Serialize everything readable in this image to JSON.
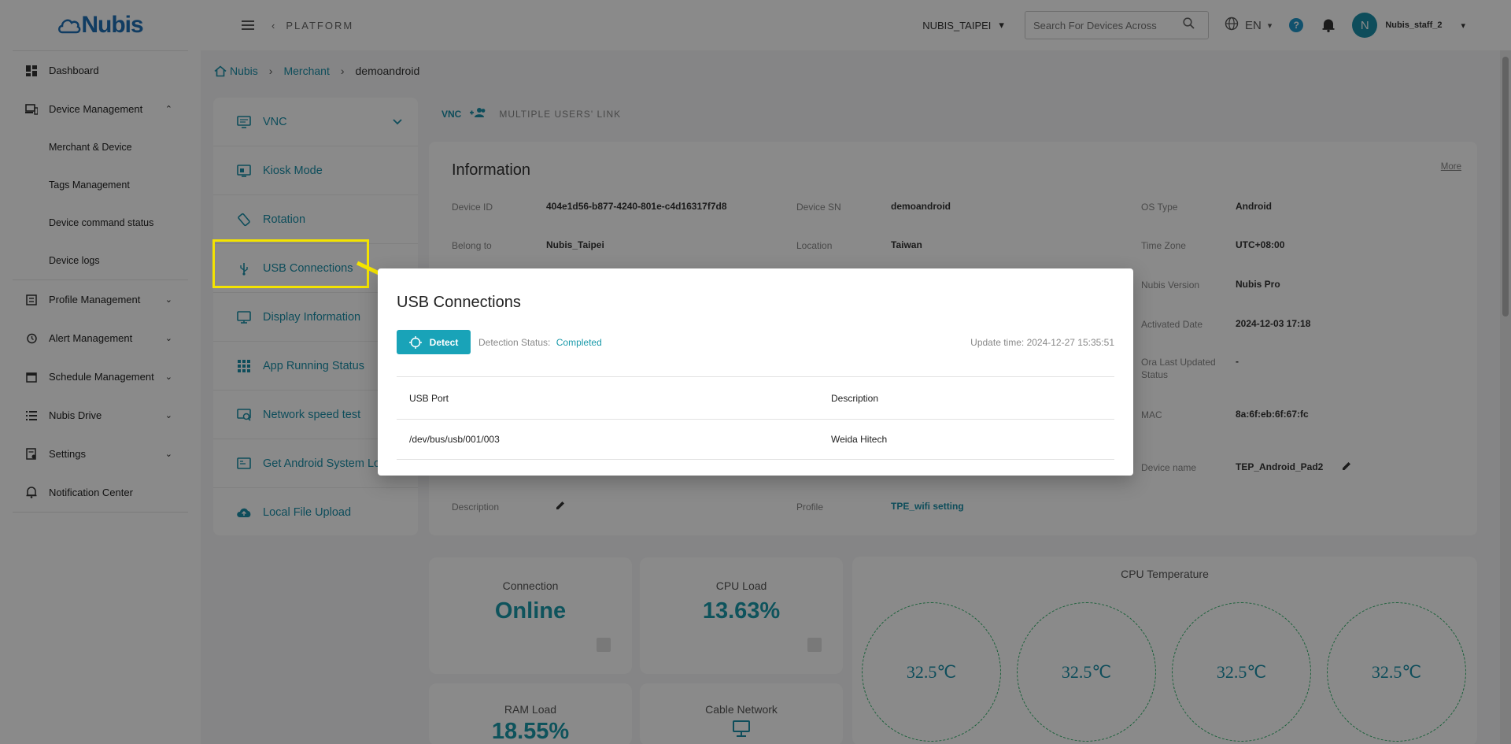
{
  "logo": {
    "text": "Nubis"
  },
  "sidebar": {
    "items": [
      {
        "label": "Dashboard",
        "icon": "dashboard-icon"
      },
      {
        "label": "Device Management",
        "icon": "devices-icon",
        "expanded": true,
        "children": [
          "Merchant & Device",
          "Tags Management",
          "Device command status",
          "Device logs"
        ]
      },
      {
        "label": "Profile Management",
        "icon": "profile-icon"
      },
      {
        "label": "Alert Management",
        "icon": "alarm-icon"
      },
      {
        "label": "Schedule Management",
        "icon": "calendar-icon"
      },
      {
        "label": "Nubis Drive",
        "icon": "list-icon"
      },
      {
        "label": "Settings",
        "icon": "settings-icon"
      },
      {
        "label": "Notification Center",
        "icon": "bell-icon"
      }
    ]
  },
  "header": {
    "platform_label": "PLATFORM",
    "merchant": "NUBIS_TAIPEI",
    "search_placeholder": "Search For Devices Across",
    "language": "EN",
    "help": "?",
    "user_initial": "N",
    "user_name": "Nubis_staff_2"
  },
  "breadcrumb": {
    "home": "Nubis",
    "middle": "Merchant",
    "current": "demoandroid"
  },
  "function_menu": [
    {
      "label": "VNC",
      "icon": "monitor-icon"
    },
    {
      "label": "Kiosk Mode",
      "icon": "kiosk-icon"
    },
    {
      "label": "Rotation",
      "icon": "rotation-icon"
    },
    {
      "label": "USB Connections",
      "icon": "usb-icon"
    },
    {
      "label": "Display Information",
      "icon": "display-icon"
    },
    {
      "label": "App Running Status",
      "icon": "apps-grid-icon"
    },
    {
      "label": "Network speed test",
      "icon": "speed-icon"
    },
    {
      "label": "Get Android System Log",
      "icon": "log-icon"
    },
    {
      "label": "Local File Upload",
      "icon": "cloud-upload-icon"
    }
  ],
  "tabs": {
    "vnc": "VNC",
    "multi": "MULTIPLE USERS' LINK"
  },
  "info": {
    "title": "Information",
    "more": "More",
    "fields": {
      "device_id": {
        "label": "Device ID",
        "value": "404e1d56-b877-4240-801e-c4d16317f7d8"
      },
      "device_sn": {
        "label": "Device SN",
        "value": "demoandroid"
      },
      "os_type": {
        "label": "OS Type",
        "value": "Android"
      },
      "belong_to": {
        "label": "Belong to",
        "value": "Nubis_Taipei"
      },
      "location": {
        "label": "Location",
        "value": "Taiwan"
      },
      "time_zone": {
        "label": "Time Zone",
        "value": "UTC+08:00"
      },
      "nubis_version": {
        "label": "Nubis Version",
        "value": "Nubis Pro"
      },
      "activated_date": {
        "label": "Activated Date",
        "value": "2024-12-03 17:18"
      },
      "ora_last_updated": {
        "label": "Ora Last Updated Status",
        "value": "-"
      },
      "mac": {
        "label": "MAC",
        "value": "8a:6f:eb:6f:67:fc"
      },
      "device_name": {
        "label": "Device name",
        "value": "TEP_Android_Pad2"
      },
      "description": {
        "label": "Description",
        "value": ""
      },
      "profile": {
        "label": "Profile",
        "value": "TPE_wifi setting"
      }
    }
  },
  "stats": {
    "connection": {
      "label": "Connection",
      "value": "Online"
    },
    "cpu_load": {
      "label": "CPU Load",
      "value": "13.63%"
    },
    "ram_load": {
      "label": "RAM Load",
      "value": "18.55%"
    },
    "cable_network": {
      "label": "Cable Network"
    }
  },
  "cpu_temperature": {
    "title": "CPU Temperature",
    "values": [
      "32.5℃",
      "32.5℃",
      "32.5℃",
      "32.5℃"
    ]
  },
  "dialog": {
    "title": "USB Connections",
    "detect_label": "Detect",
    "status_label": "Detection Status:",
    "status_value": "Completed",
    "update_label": "Update time:",
    "update_value": "2024-12-27 15:35:51",
    "columns": [
      "USB Port",
      "Description"
    ],
    "rows": [
      {
        "port": "/dev/bus/usb/001/003",
        "description": "Weida Hitech"
      }
    ]
  },
  "colors": {
    "accent": "#1a8fa8",
    "button": "#19a3b8",
    "highlight": "#f4e400",
    "temp_ring": "#2fb16a"
  }
}
